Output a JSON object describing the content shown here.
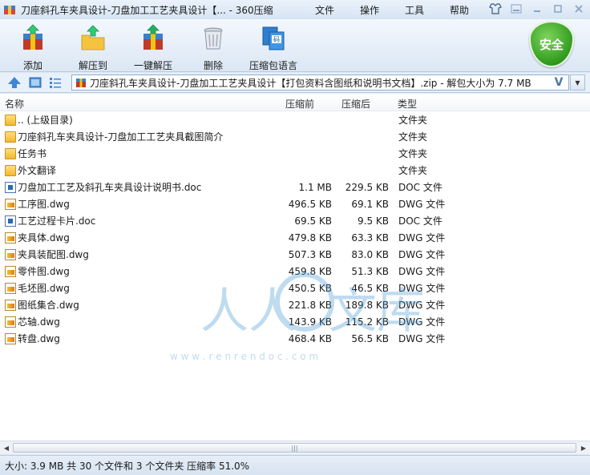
{
  "window": {
    "title": "刀座斜孔车夹具设计-刀盘加工工艺夹具设计【... - 360压缩"
  },
  "menu": [
    "文件",
    "操作",
    "工具",
    "帮助"
  ],
  "toolbar": {
    "add": "添加",
    "extract_to": "解压到",
    "one_click_extract": "一键解压",
    "delete": "删除",
    "comment": "压缩包语言",
    "safety_badge": "安全"
  },
  "address": {
    "path": "刀座斜孔车夹具设计-刀盘加工工艺夹具设计【打包资料含图纸和说明书文档】.zip - 解包大小为 7.7 MB"
  },
  "columns": {
    "name": "名称",
    "size": "压缩前",
    "packed": "压缩后",
    "type": "类型"
  },
  "files": [
    {
      "name": ".. (上级目录)",
      "size": "",
      "packed": "",
      "type": "文件夹",
      "kind": "folder"
    },
    {
      "name": "刀座斜孔车夹具设计-刀盘加工工艺夹具截图简介",
      "size": "",
      "packed": "",
      "type": "文件夹",
      "kind": "folder"
    },
    {
      "name": "任务书",
      "size": "",
      "packed": "",
      "type": "文件夹",
      "kind": "folder"
    },
    {
      "name": "外文翻译",
      "size": "",
      "packed": "",
      "type": "文件夹",
      "kind": "folder"
    },
    {
      "name": "刀盘加工工艺及斜孔车夹具设计说明书.doc",
      "size": "1.1 MB",
      "packed": "229.5 KB",
      "type": "DOC 文件",
      "kind": "doc"
    },
    {
      "name": "工序图.dwg",
      "size": "496.5 KB",
      "packed": "69.1 KB",
      "type": "DWG 文件",
      "kind": "dwg"
    },
    {
      "name": "工艺过程卡片.doc",
      "size": "69.5 KB",
      "packed": "9.5 KB",
      "type": "DOC 文件",
      "kind": "doc"
    },
    {
      "name": "夹具体.dwg",
      "size": "479.8 KB",
      "packed": "63.3 KB",
      "type": "DWG 文件",
      "kind": "dwg"
    },
    {
      "name": "夹具装配图.dwg",
      "size": "507.3 KB",
      "packed": "83.0 KB",
      "type": "DWG 文件",
      "kind": "dwg"
    },
    {
      "name": "零件图.dwg",
      "size": "459.8 KB",
      "packed": "51.3 KB",
      "type": "DWG 文件",
      "kind": "dwg"
    },
    {
      "name": "毛坯图.dwg",
      "size": "450.5 KB",
      "packed": "46.5 KB",
      "type": "DWG 文件",
      "kind": "dwg"
    },
    {
      "name": "图纸集合.dwg",
      "size": "221.8 KB",
      "packed": "189.8 KB",
      "type": "DWG 文件",
      "kind": "dwg"
    },
    {
      "name": "芯轴.dwg",
      "size": "143.9 KB",
      "packed": "115.2 KB",
      "type": "DWG 文件",
      "kind": "dwg"
    },
    {
      "name": "转盘.dwg",
      "size": "468.4 KB",
      "packed": "56.5 KB",
      "type": "DWG 文件",
      "kind": "dwg"
    }
  ],
  "watermark": {
    "left_text": "人人",
    "right_text": "文库",
    "url": "w w w . r e n r e n d o c . c o m"
  },
  "status": {
    "text": "大小: 3.9 MB 共 30 个文件和 3 个文件夹 压缩率 51.0%"
  }
}
